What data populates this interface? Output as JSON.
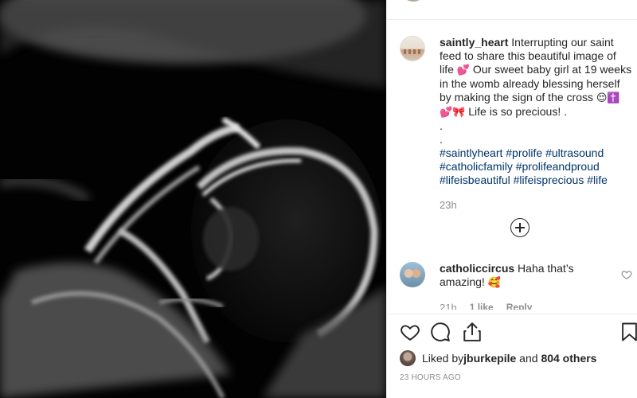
{
  "post": {
    "author": "saintly_heart",
    "caption_part1": "Interrupting our saint feed to share this beautiful image of life ",
    "caption_emoji1": "💕",
    "caption_part2": " Our sweet baby girl at 19 weeks in the womb already blessing herself by making the sign of the cross ",
    "caption_emoji2": "😌✝️💕🎀",
    "caption_part3": " Life is so precious! .",
    "caption_dot1": ".",
    "caption_dot2": ".",
    "hashtags": "#saintlyheart #prolife #ultrasound #catholicfamily #prolifeandproud #lifeisbeautiful #lifeisprecious #life",
    "caption_time": "23h"
  },
  "comment": {
    "author": "catholiccircus",
    "text": "Haha that’s amazing! ",
    "emoji": "🥰",
    "time": "21h",
    "likes": "1 like",
    "reply": "Reply"
  },
  "likes": {
    "prefix": "Liked by ",
    "user": "jburkepile",
    "middle": " and ",
    "others": "804 others"
  },
  "posted_time": "23 HOURS AGO",
  "icons": {
    "like": "heart-icon",
    "comment": "comment-icon",
    "share": "share-icon",
    "save": "bookmark-icon",
    "add_comment": "plus-circle-icon",
    "comment_like": "small-heart-icon"
  },
  "colors": {
    "text": "#262626",
    "muted": "#8e8e8e",
    "hashtag": "#003569",
    "divider": "#efefef"
  }
}
